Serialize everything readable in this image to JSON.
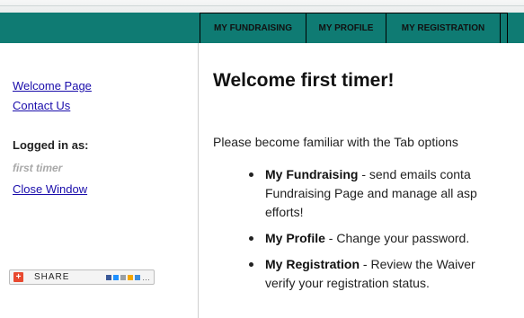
{
  "header": {
    "tabs": [
      {
        "label": "MY FUNDRAISING"
      },
      {
        "label": "MY PROFILE"
      },
      {
        "label": "MY REGISTRATION"
      }
    ]
  },
  "sidebar": {
    "links": [
      {
        "label": "Welcome Page"
      },
      {
        "label": "Contact Us"
      }
    ],
    "logged_in_label": "Logged in as:",
    "username": "first timer",
    "close_window": "Close Window",
    "share_label": "SHARE",
    "share_plus": "+"
  },
  "main": {
    "title": "Welcome first timer!",
    "intro": "Please become familiar with the Tab options",
    "bullets": [
      {
        "term": "My Fundraising",
        "text": " - send emails conta",
        "line2": "Fundraising Page and manage all asp",
        "line3": "efforts!"
      },
      {
        "term": "My Profile",
        "text": " - Change your password."
      },
      {
        "term": "My Registration",
        "text": " - Review the Waiver",
        "line2": "verify your registration status."
      }
    ]
  },
  "colors": {
    "header_teal": "#0f7b73",
    "link": "#1a0dab",
    "share_accent": "#e8492f"
  }
}
